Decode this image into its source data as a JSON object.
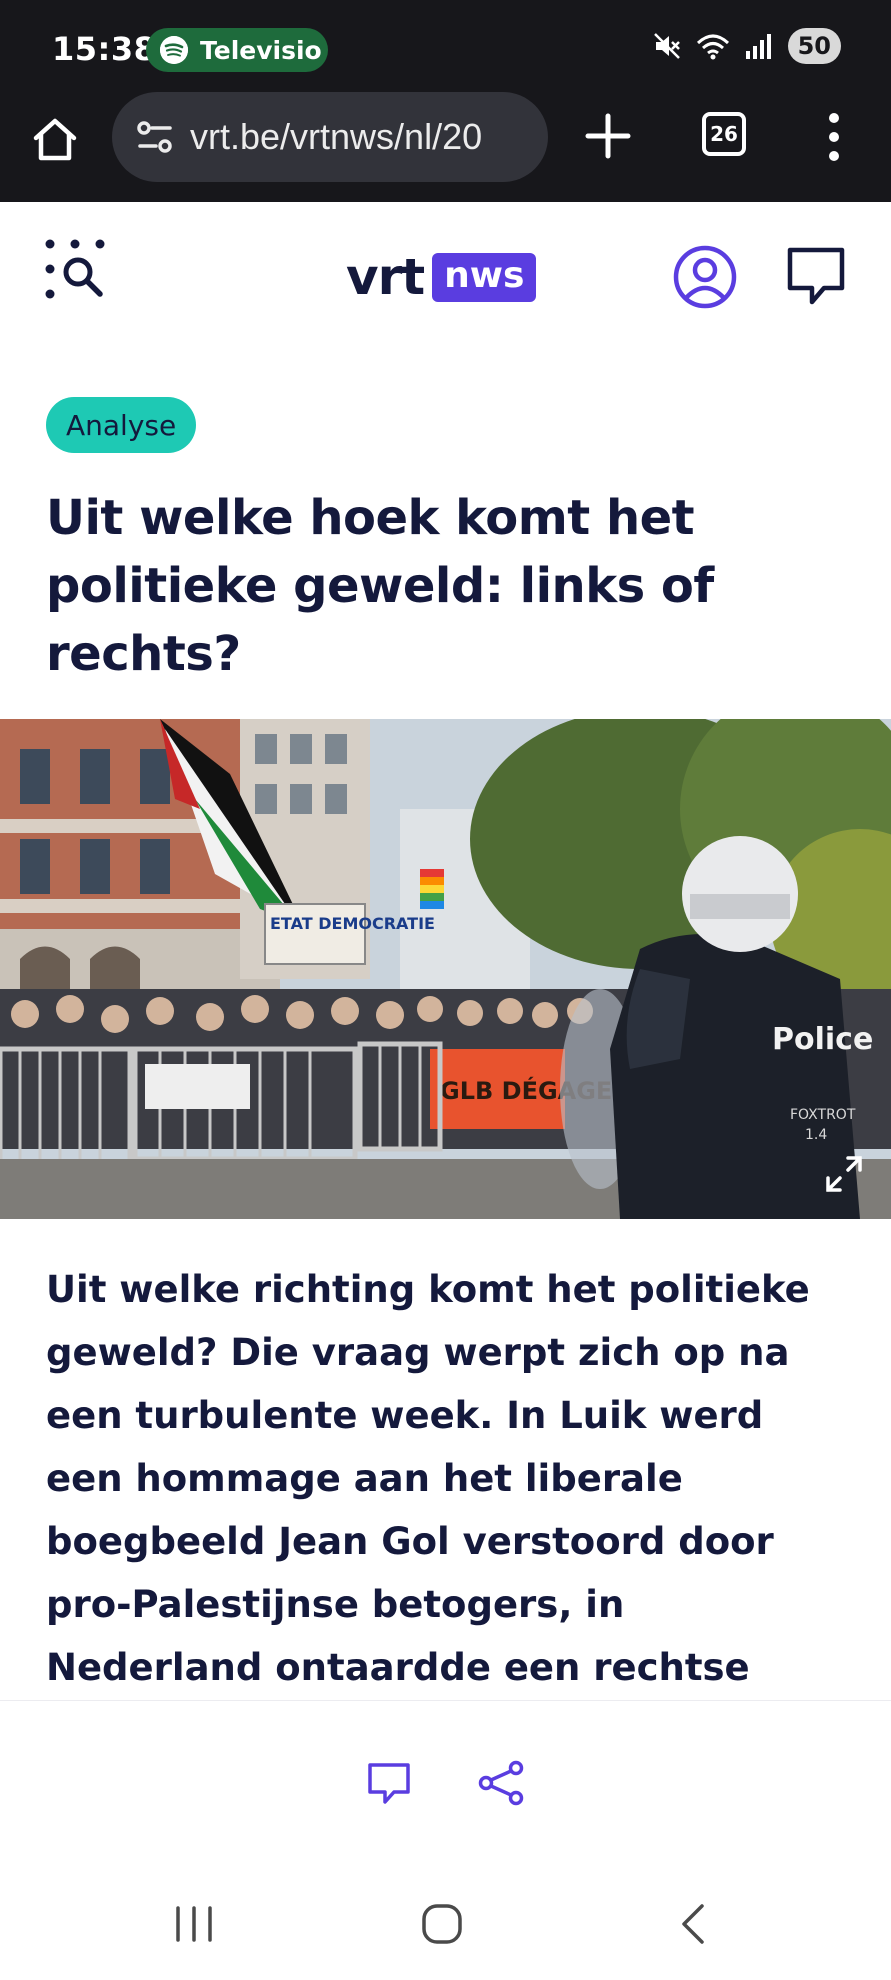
{
  "status_bar": {
    "time": "15:38",
    "now_playing": "Televisio",
    "battery": "50",
    "icons": [
      "mute-icon",
      "wifi-icon",
      "signal-icon"
    ]
  },
  "browser": {
    "url": "vrt.be/vrtnws/nl/20",
    "tab_count": "26"
  },
  "site": {
    "logo_text": "vrt",
    "logo_badge": "nws",
    "brand_color": "#5a3de0"
  },
  "article": {
    "tag": "Analyse",
    "tag_color": "#1ec9b4",
    "headline": "Uit welke hoek komt het politieke geweld: links of rechts?",
    "lead": "Uit welke richting komt het politieke geweld? Die vraag werpt zich op na een turbulente week. In Luik werd een hommage aan het liberale boegbeeld Jean Gol verstoord door pro-Palestijnse betogers, in Nederland ontaardde een rechtse betoging tegen een te laks",
    "hero_image": {
      "police_label": "Police",
      "police_sub": "FOXTROT",
      "police_num": "1.4",
      "banner": "GLB DÉGAGE",
      "sign": "ETAT DEMOCRATIE"
    }
  }
}
